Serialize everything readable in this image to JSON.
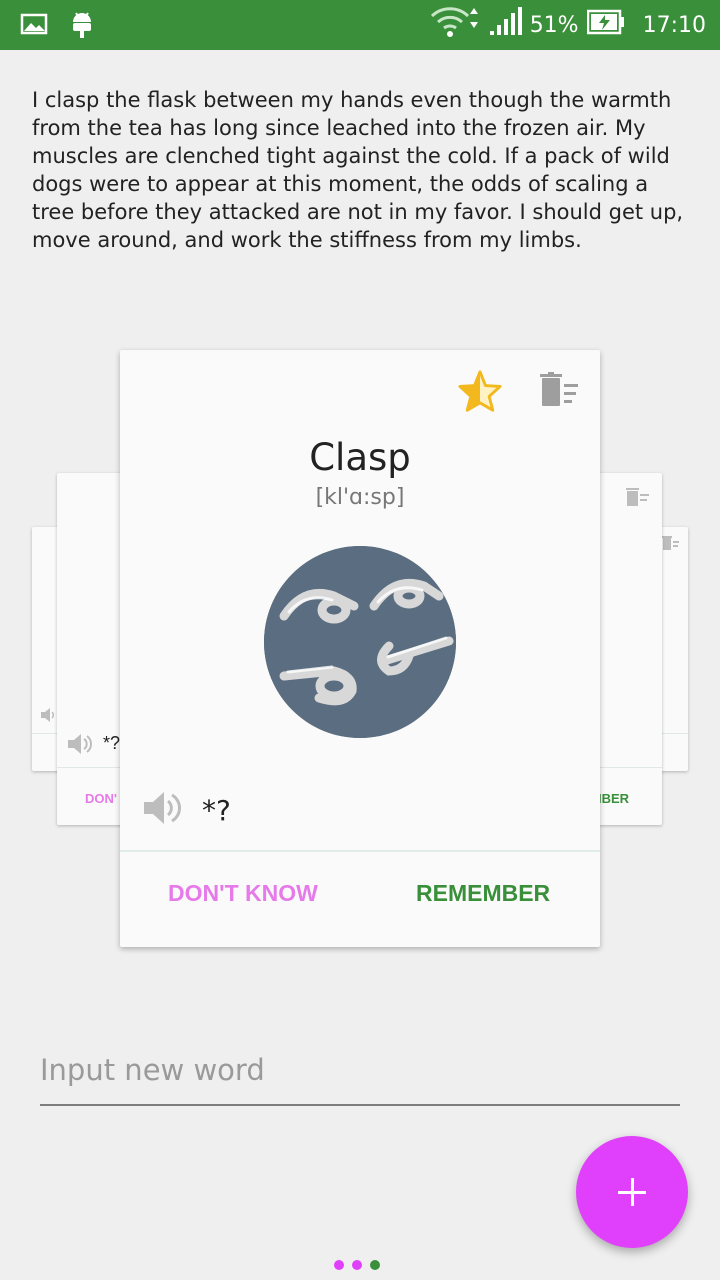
{
  "status_bar": {
    "battery": "51%",
    "time": "17:10"
  },
  "passage": "I clasp the flask between my hands even though the warmth from the tea has long since leached into the frozen air. My muscles are clenched tight against the cold. If a pack of wild dogs were to appear at this moment, the odds of scaling a tree before they attacked are not in my favor.  I should get up, move around, and work the stiffness from my limbs.",
  "card": {
    "word": "Clasp",
    "phonetic": "[kl'ɑ:sp]",
    "audio_text": "*?",
    "dont_know_label": "DON'T KNOW",
    "remember_label": "REMEMBER",
    "star_icon": "star-half-icon",
    "delete_icon": "trash-icon"
  },
  "background_cards": {
    "left_audio_text": "*?",
    "left_button_fragment": "DON'",
    "right_button_fragment": "IBER"
  },
  "input": {
    "placeholder": "Input new word"
  },
  "pager": {
    "dots": [
      "#e040fb",
      "#e040fb",
      "#3a8f3a"
    ]
  },
  "colors": {
    "status_bar": "#3a8f3a",
    "accent_pink": "#e040fb",
    "dont_know": "#e57ae8",
    "remember": "#3a8f3a"
  }
}
